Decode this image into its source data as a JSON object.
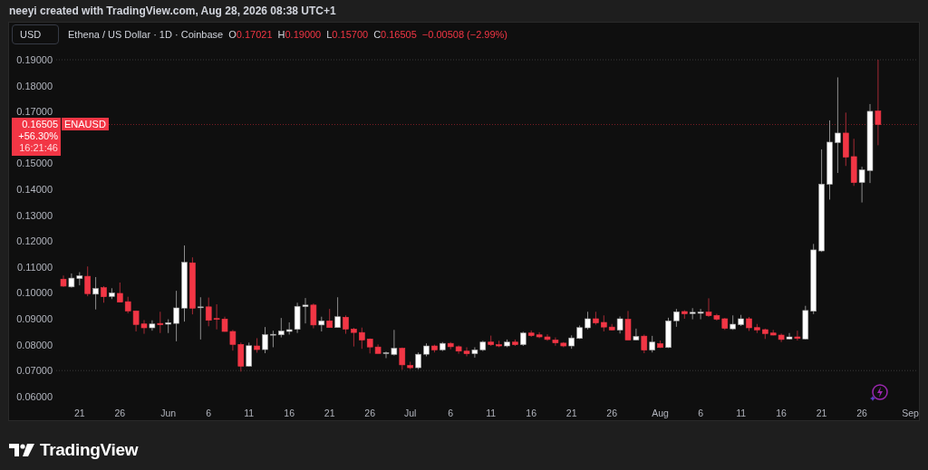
{
  "attribution": "neeyi created with TradingView.com, Aug 28, 2026 08:38 UTC+1",
  "currency_button": {
    "label": "USD"
  },
  "legend": {
    "symbol_title": "Ethena / US Dollar · 1D · Coinbase",
    "ohlc": [
      {
        "label": "O",
        "value": "0.17021"
      },
      {
        "label": "H",
        "value": "0.19000"
      },
      {
        "label": "L",
        "value": "0.15700"
      },
      {
        "label": "C",
        "value": "0.16505"
      }
    ],
    "change": "−0.00508 (−2.99%)"
  },
  "last_price": {
    "price": "0.16505",
    "change": "+56.30%",
    "countdown": "16:21:46",
    "symbol": "ENAUSD"
  },
  "chart": {
    "chart_data": {
      "type": "candlestick",
      "yticks": [
        {
          "value": 0.06,
          "label": "0.06000"
        },
        {
          "value": 0.07,
          "label": "0.07000"
        },
        {
          "value": 0.08,
          "label": "0.08000"
        },
        {
          "value": 0.09,
          "label": "0.09000"
        },
        {
          "value": 0.1,
          "label": "0.10000"
        },
        {
          "value": 0.11,
          "label": "0.11000"
        },
        {
          "value": 0.12,
          "label": "0.12000"
        },
        {
          "value": 0.13,
          "label": "0.13000"
        },
        {
          "value": 0.14,
          "label": "0.14000"
        },
        {
          "value": 0.15,
          "label": "0.15000"
        },
        {
          "value": 0.17,
          "label": "0.17000"
        },
        {
          "value": 0.18,
          "label": "0.18000"
        },
        {
          "value": 0.19,
          "label": "0.19000"
        }
      ],
      "categories": [
        null,
        null,
        "21",
        null,
        null,
        null,
        null,
        "26",
        null,
        null,
        null,
        null,
        null,
        "Jun",
        null,
        null,
        null,
        null,
        "6",
        null,
        null,
        null,
        null,
        "11",
        null,
        null,
        null,
        null,
        "16",
        null,
        null,
        null,
        null,
        "21",
        null,
        null,
        null,
        null,
        "26",
        null,
        null,
        null,
        null,
        "Jul",
        null,
        null,
        null,
        null,
        "6",
        null,
        null,
        null,
        null,
        "11",
        null,
        null,
        null,
        null,
        "16",
        null,
        null,
        null,
        null,
        "21",
        null,
        null,
        null,
        null,
        "26",
        null,
        null,
        null,
        null,
        null,
        "Aug",
        null,
        null,
        null,
        null,
        "6",
        null,
        null,
        null,
        null,
        "11",
        null,
        null,
        null,
        null,
        "16",
        null,
        null,
        null,
        null,
        "21",
        null,
        null,
        null,
        null,
        "26",
        null,
        null,
        null,
        null,
        null,
        "Sep"
      ],
      "ref_lines": [
        {
          "axis": "y",
          "value": 0.165
        }
      ],
      "ylim": [
        0.06,
        0.19
      ],
      "ohlc": [
        [
          0.1053,
          0.1067,
          0.1023,
          0.1026
        ],
        [
          0.1023,
          0.1075,
          0.102,
          0.1057
        ],
        [
          0.1055,
          0.108,
          0.1029,
          0.1066
        ],
        [
          0.1064,
          0.1102,
          0.0987,
          0.0997
        ],
        [
          0.0995,
          0.1061,
          0.0936,
          0.1017
        ],
        [
          0.102,
          0.1026,
          0.0962,
          0.0985
        ],
        [
          0.0986,
          0.1018,
          0.0976,
          0.1
        ],
        [
          0.0998,
          0.104,
          0.0964,
          0.0964
        ],
        [
          0.0966,
          0.0985,
          0.0921,
          0.093
        ],
        [
          0.093,
          0.0932,
          0.0851,
          0.0878
        ],
        [
          0.088,
          0.0895,
          0.0842,
          0.0865
        ],
        [
          0.0865,
          0.0894,
          0.0854,
          0.088
        ],
        [
          0.0882,
          0.0927,
          0.0845,
          0.0877
        ],
        [
          0.0879,
          0.0898,
          0.0845,
          0.0885
        ],
        [
          0.0882,
          0.1008,
          0.0813,
          0.0942
        ],
        [
          0.0941,
          0.1183,
          0.0889,
          0.1118
        ],
        [
          0.1116,
          0.1137,
          0.0917,
          0.0941
        ],
        [
          0.0943,
          0.0983,
          0.082,
          0.0946
        ],
        [
          0.0946,
          0.0982,
          0.0871,
          0.0894
        ],
        [
          0.0901,
          0.0956,
          0.0859,
          0.0899
        ],
        [
          0.0899,
          0.0908,
          0.085,
          0.0851
        ],
        [
          0.0851,
          0.0857,
          0.0777,
          0.0801
        ],
        [
          0.0801,
          0.0808,
          0.0696,
          0.0717
        ],
        [
          0.0717,
          0.0808,
          0.0715,
          0.0796
        ],
        [
          0.0795,
          0.0825,
          0.0769,
          0.0781
        ],
        [
          0.0781,
          0.0868,
          0.0767,
          0.0839
        ],
        [
          0.0837,
          0.0854,
          0.079,
          0.084
        ],
        [
          0.0838,
          0.0903,
          0.0828,
          0.0853
        ],
        [
          0.0851,
          0.0886,
          0.0839,
          0.0858
        ],
        [
          0.0859,
          0.0962,
          0.0845,
          0.0948
        ],
        [
          0.0947,
          0.098,
          0.0882,
          0.0953
        ],
        [
          0.0953,
          0.0959,
          0.0863,
          0.0876
        ],
        [
          0.0876,
          0.0908,
          0.0851,
          0.0892
        ],
        [
          0.0892,
          0.0938,
          0.0866,
          0.0866
        ],
        [
          0.0866,
          0.0983,
          0.0866,
          0.0908
        ],
        [
          0.0906,
          0.0913,
          0.0842,
          0.086
        ],
        [
          0.086,
          0.0865,
          0.0793,
          0.0847
        ],
        [
          0.0847,
          0.0866,
          0.0784,
          0.0818
        ],
        [
          0.0822,
          0.0824,
          0.0766,
          0.0791
        ],
        [
          0.0791,
          0.0801,
          0.0766,
          0.0766
        ],
        [
          0.0766,
          0.0773,
          0.0748,
          0.0769
        ],
        [
          0.0762,
          0.0857,
          0.0758,
          0.0786
        ],
        [
          0.0786,
          0.0789,
          0.0703,
          0.0722
        ],
        [
          0.072,
          0.0734,
          0.0705,
          0.0711
        ],
        [
          0.0711,
          0.077,
          0.0705,
          0.0763
        ],
        [
          0.0763,
          0.0805,
          0.0755,
          0.0795
        ],
        [
          0.0795,
          0.08,
          0.077,
          0.078
        ],
        [
          0.078,
          0.081,
          0.0775,
          0.0805
        ],
        [
          0.0805,
          0.081,
          0.0782,
          0.0792
        ],
        [
          0.0792,
          0.0797,
          0.0765,
          0.0775
        ],
        [
          0.0775,
          0.079,
          0.0755,
          0.0765
        ],
        [
          0.0765,
          0.079,
          0.075,
          0.078
        ],
        [
          0.078,
          0.0815,
          0.0775,
          0.081
        ],
        [
          0.081,
          0.0835,
          0.0795,
          0.08
        ],
        [
          0.08,
          0.0815,
          0.079,
          0.0795
        ],
        [
          0.0795,
          0.082,
          0.079,
          0.081
        ],
        [
          0.081,
          0.082,
          0.0795,
          0.08
        ],
        [
          0.08,
          0.085,
          0.0795,
          0.0845
        ],
        [
          0.0845,
          0.0855,
          0.083,
          0.0835
        ],
        [
          0.0838,
          0.0848,
          0.0825,
          0.083
        ],
        [
          0.083,
          0.084,
          0.0815,
          0.082
        ],
        [
          0.0818,
          0.0828,
          0.0796,
          0.0807
        ],
        [
          0.0806,
          0.081,
          0.079,
          0.0795
        ],
        [
          0.0795,
          0.0836,
          0.0784,
          0.0826
        ],
        [
          0.0824,
          0.0874,
          0.0822,
          0.0866
        ],
        [
          0.0865,
          0.0927,
          0.0859,
          0.09
        ],
        [
          0.09,
          0.0927,
          0.0877,
          0.0884
        ],
        [
          0.0886,
          0.0913,
          0.0851,
          0.0868
        ],
        [
          0.0868,
          0.088,
          0.0855,
          0.0857
        ],
        [
          0.0856,
          0.0909,
          0.0843,
          0.09
        ],
        [
          0.0898,
          0.093,
          0.0818,
          0.0818
        ],
        [
          0.0818,
          0.0862,
          0.0816,
          0.0832
        ],
        [
          0.0833,
          0.0839,
          0.0767,
          0.0779
        ],
        [
          0.0779,
          0.0834,
          0.077,
          0.081
        ],
        [
          0.0804,
          0.0816,
          0.0787,
          0.0789
        ],
        [
          0.0789,
          0.0904,
          0.0787,
          0.0892
        ],
        [
          0.0892,
          0.0938,
          0.0869,
          0.0927
        ],
        [
          0.0928,
          0.0933,
          0.09,
          0.0919
        ],
        [
          0.092,
          0.0941,
          0.0898,
          0.0925
        ],
        [
          0.0921,
          0.0938,
          0.0898,
          0.0926
        ],
        [
          0.0926,
          0.0979,
          0.0907,
          0.0912
        ],
        [
          0.0913,
          0.0919,
          0.0893,
          0.0898
        ],
        [
          0.09,
          0.0903,
          0.0857,
          0.0863
        ],
        [
          0.0861,
          0.0913,
          0.0857,
          0.0879
        ],
        [
          0.0877,
          0.0915,
          0.0872,
          0.09
        ],
        [
          0.09,
          0.0907,
          0.0853,
          0.0865
        ],
        [
          0.0866,
          0.088,
          0.0845,
          0.0857
        ],
        [
          0.0858,
          0.0862,
          0.0822,
          0.0843
        ],
        [
          0.0845,
          0.0857,
          0.0836,
          0.0837
        ],
        [
          0.0837,
          0.0843,
          0.081,
          0.082
        ],
        [
          0.0822,
          0.0845,
          0.082,
          0.083
        ],
        [
          0.083,
          0.0854,
          0.0816,
          0.0824
        ],
        [
          0.0822,
          0.095,
          0.082,
          0.0932
        ],
        [
          0.0929,
          0.1189,
          0.0918,
          0.1166
        ],
        [
          0.1162,
          0.1554,
          0.1158,
          0.142
        ],
        [
          0.1419,
          0.1666,
          0.136,
          0.1582
        ],
        [
          0.158,
          0.1832,
          0.1463,
          0.1617
        ],
        [
          0.1617,
          0.1696,
          0.149,
          0.1524
        ],
        [
          0.1526,
          0.1595,
          0.1413,
          0.1426
        ],
        [
          0.1426,
          0.1487,
          0.1349,
          0.1475
        ],
        [
          0.1472,
          0.1729,
          0.1424,
          0.1701
        ],
        [
          0.1702,
          0.19,
          0.157,
          0.165
        ],
        null,
        null,
        null,
        null
      ]
    }
  },
  "brand": {
    "name": "TradingView"
  }
}
